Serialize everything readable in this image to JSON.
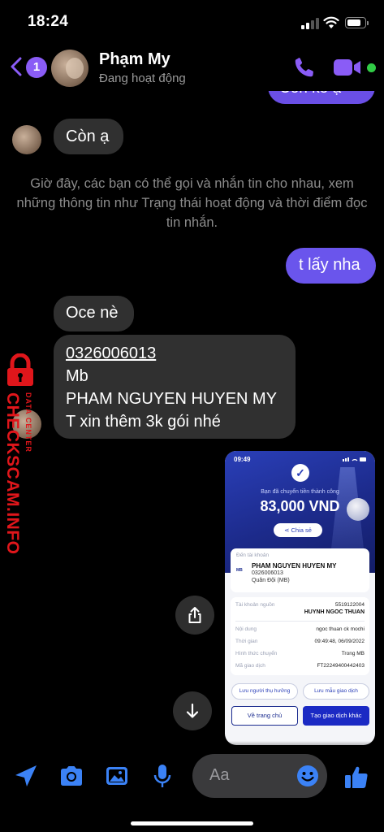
{
  "status_bar": {
    "time": "18:24",
    "battery_level": 0.85
  },
  "header": {
    "unread_count": "1",
    "contact_name": "Phạm My",
    "contact_status": "Đang hoạt động",
    "accent_color": "#8a5cf6",
    "online_color": "#31cc46"
  },
  "messages": {
    "partial_outgoing": "Còn ko ạ",
    "incoming_1": "Còn ạ",
    "system_note": "Giờ đây, các bạn có thể gọi và nhắn tin cho nhau, xem những thông tin như Trạng thái hoạt động và thời điểm đọc tin nhắn.",
    "outgoing_1": "t lấy nha",
    "incoming_2": "Oce nè",
    "incoming_3": {
      "account_number": "0326006013",
      "bank": "Mb",
      "account_name": "PHAM NGUYEN HUYEN MY",
      "note": "T xin thêm 3k gói nhé"
    }
  },
  "watermark": {
    "brand": "CHECKSCAM.INFO",
    "subtitle": "DATA CENTER"
  },
  "receipt": {
    "time": "09:49",
    "success_text": "Bạn đã chuyển tiền thành công",
    "amount": "83,000 VND",
    "share_label": "Chia sẻ",
    "to_account_label": "Đến tài khoản",
    "bank_logo": "MB",
    "recipient_name": "PHAM NGUYEN HUYEN MY",
    "recipient_account": "0326006013",
    "recipient_bank": "Quân Đội (MB)",
    "source_label": "Tài khoản nguồn",
    "source_account": "5519122004",
    "source_name": "HUYNH NGOC THUAN",
    "content_label": "Nội dung",
    "content_value": "ngoc thuan ck mochi",
    "time_label": "Thời gian",
    "time_value": "09:49:48, 06/09/2022",
    "method_label": "Hình thức chuyển",
    "method_value": "Trong MB",
    "txn_label": "Mã giao dịch",
    "txn_value": "FT22249400442403",
    "save_beneficiary": "Lưu người thụ hưởng",
    "save_template": "Lưu mẫu giao dịch",
    "home_button": "Về trang chủ",
    "new_txn_button": "Tạo giao dịch khác"
  },
  "composer": {
    "placeholder": "Aa",
    "icons": [
      "location-icon",
      "camera-icon",
      "image-icon",
      "microphone-icon",
      "emoji-icon",
      "like-icon"
    ],
    "icon_color": "#3b82f6"
  }
}
